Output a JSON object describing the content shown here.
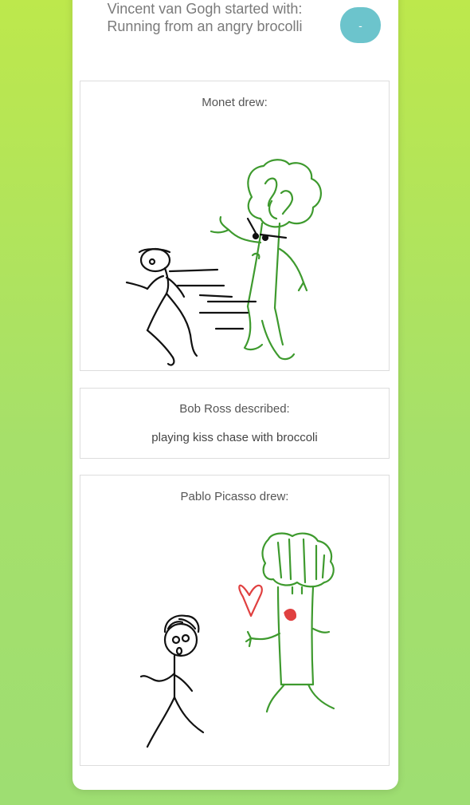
{
  "header": {
    "text": "Vincent van Gogh started with: Running from an angry brocolli",
    "toggle_label": "-"
  },
  "entries": [
    {
      "title": "Monet drew:"
    },
    {
      "title": "Bob Ross described:",
      "description": "playing kiss chase with broccoli"
    },
    {
      "title": "Pablo Picasso drew:"
    }
  ],
  "colors": {
    "accent": "#6cc4cc",
    "broccoli_green": "#3e9a2e",
    "heart_red": "#e04040"
  }
}
